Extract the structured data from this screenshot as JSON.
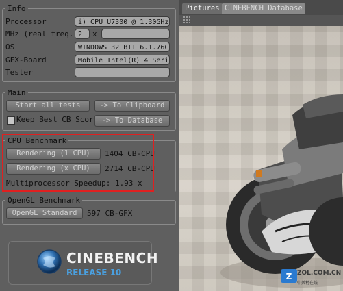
{
  "info": {
    "legend": "Info",
    "processor_label": "Processor",
    "processor_value": "i) CPU U7300 @ 1.30GHz",
    "mhz_label": "MHz (real freq.)",
    "mhz_value": "2",
    "mhz_x": "x",
    "os_label": "OS",
    "os_value": "WINDOWS 32 BIT 6.1.76C",
    "gfx_label": "GFX-Board",
    "gfx_value": "Mobile Intel(R) 4 Seri",
    "tester_label": "Tester",
    "tester_value": ""
  },
  "main": {
    "legend": "Main",
    "start_all": "Start all tests",
    "to_clipboard": "-> To Clipboard",
    "keep_best": "Keep Best CB Score",
    "to_database": "-> To Database",
    "keep_best_checked": false
  },
  "cpu": {
    "legend": "CPU Benchmark",
    "render_1": "Rendering (1 CPU)",
    "render_1_result": "1404 CB-CPU",
    "render_x": "Rendering (x CPU)",
    "render_x_result": "2714 CB-CPU",
    "speedup": "Multiprocessor Speedup: 1.93 x"
  },
  "opengl": {
    "legend": "OpenGL Benchmark",
    "standard": "OpenGL Standard",
    "result": "597 CB-GFX"
  },
  "logo": {
    "name": "CINEBENCH",
    "release": "RELEASE 10"
  },
  "tabs": [
    "Pictures",
    "CINEBENCH Database"
  ],
  "watermark": "ZOL.COM.CN",
  "watermark_sub": "中关村在线",
  "colors": {
    "highlight": "#e02020",
    "release_blue": "#4aa0e0"
  }
}
